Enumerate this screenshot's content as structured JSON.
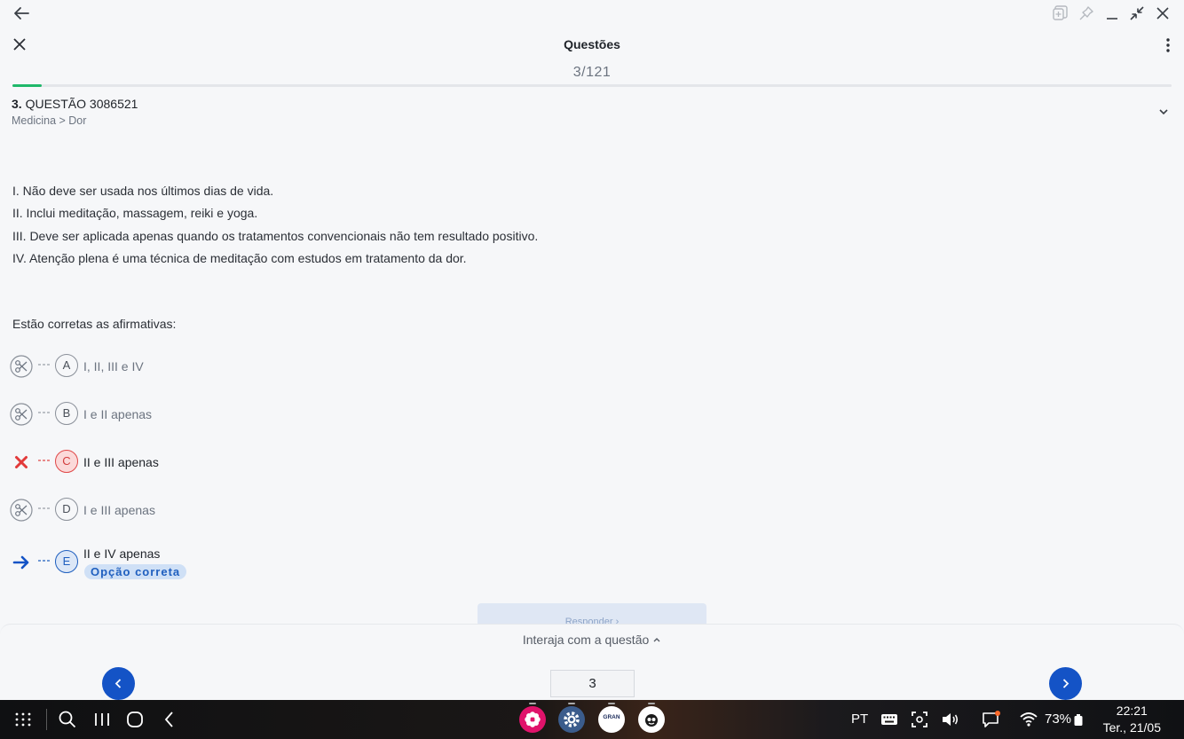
{
  "window": {
    "back_icon": "arrow-left-icon",
    "controls": [
      "multiwindow-icon",
      "pin-icon",
      "minimize-icon",
      "shrink-icon",
      "close-icon"
    ]
  },
  "header": {
    "title": "Questões",
    "counter": "3/121",
    "progress_fraction": 0.025,
    "accent": "#1fb86a"
  },
  "question": {
    "number": "3.",
    "title": "QUESTÃO 3086521",
    "category": "Medicina > Dor",
    "statements": [
      "I. Não deve ser usada nos últimos dias de vida.",
      "II. Inclui meditação, massagem, reiki e yoga.",
      "III. Deve ser aplicada apenas quando os tratamentos convencionais não tem resultado positivo.",
      "IV. Atenção plena é uma técnica de meditação com estudos em tratamento da dor."
    ],
    "prompt": "Estão corretas as afirmativas:",
    "options": [
      {
        "letter": "A",
        "text": "I, II, III e IV",
        "state": "eliminated"
      },
      {
        "letter": "B",
        "text": "I e II apenas",
        "state": "eliminated"
      },
      {
        "letter": "C",
        "text": "II e III apenas",
        "state": "wrong"
      },
      {
        "letter": "D",
        "text": "I e III apenas",
        "state": "eliminated"
      },
      {
        "letter": "E",
        "text": "II e IV apenas",
        "state": "correct",
        "badge": "Opção correta"
      }
    ],
    "respond_label": "Responder"
  },
  "sheet": {
    "handle_label": "Interaja com a questão",
    "page_value": "3",
    "prev_icon": "chevron-left-icon",
    "next_icon": "chevron-right-icon",
    "brand_blue": "#1453c6",
    "wrong_red": "#e04848"
  },
  "taskbar": {
    "language": "PT",
    "battery": "73%",
    "time": "22:21",
    "date": "Ter., 21/05",
    "gran_label": "GRAN"
  }
}
